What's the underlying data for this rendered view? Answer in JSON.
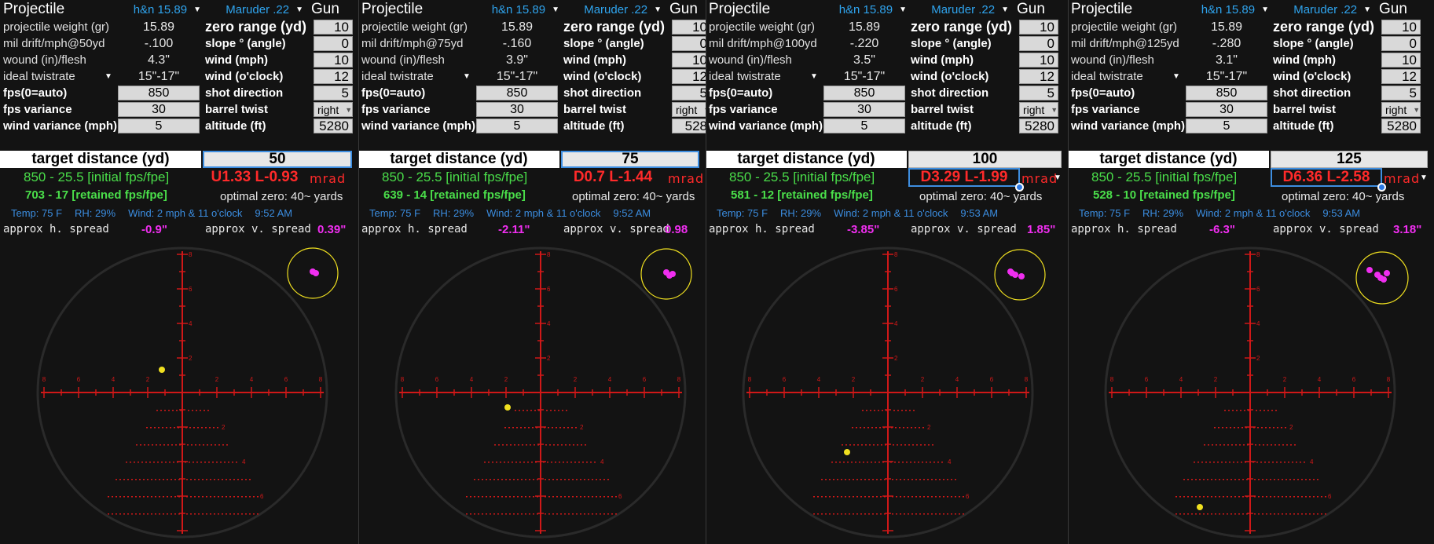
{
  "colors": {
    "background": "#131313",
    "selector_text": "#2fa4ee",
    "hold_red": "#ff2a2a",
    "fps_green": "#4ade4a",
    "spread_magenta": "#f02ef0",
    "weather_blue": "#3b8de0",
    "reticle_red": "#d01818",
    "impact_yellow": "#f0e020"
  },
  "labels": {
    "projectile": "Projectile",
    "gun": "Gun",
    "projectile_weight": "projectile weight (gr)",
    "wound": "wound (in)/flesh",
    "ideal_twistrate": "ideal twistrate",
    "fps_auto": "fps(0=auto)",
    "fps_variance": "fps variance",
    "wind_variance": "wind variance (mph)",
    "zero_range": "zero range (yd)",
    "slope": "slope ° (angle)",
    "wind_mph": "wind (mph)",
    "wind_oclock": "wind (o'clock)",
    "shot_direction": "shot direction",
    "barrel_twist": "barrel twist",
    "altitude": "altitude (ft)",
    "target_distance": "target distance (yd)",
    "approx_h_spread": "approx h. spread",
    "approx_v_spread": "approx v. spread",
    "mrad_unit": "mrad"
  },
  "panels": [
    {
      "projectile_select": "h&n 15.89",
      "gun_select": "Maruder .22",
      "projectile_weight": "15.89",
      "mil_drift_label": "mil drift/mph@50yd",
      "mil_drift": "-.100",
      "wound": "4.3\"",
      "twistrate": "15\"-17\"",
      "fps": "850",
      "fps_variance": "30",
      "wind_variance": "5",
      "zero_range": "10",
      "slope": "0",
      "wind_mph": "10",
      "wind_oclock": "12",
      "shot_direction": "5",
      "barrel_twist": "right",
      "altitude": "5280",
      "target_distance": "50",
      "initial": "850 - 25.5 [initial fps/fpe]",
      "retained": "703 - 17 [retained fps/fpe]",
      "hold": "U1.33  L-0.93",
      "optimal_zero": "optimal zero: 40~ yards",
      "temp": "Temp: 75 F",
      "rh": "RH: 29%",
      "wind_info": "Wind: 2 mph & 11 o'clock",
      "time": "9:52 AM",
      "h_spread": "-0.9\"",
      "v_spread": "0.39\""
    },
    {
      "projectile_select": "h&n 15.89",
      "gun_select": "Maruder .22",
      "projectile_weight": "15.89",
      "mil_drift_label": "mil drift/mph@75yd",
      "mil_drift": "-.160",
      "wound": "3.9\"",
      "twistrate": "15\"-17\"",
      "fps": "850",
      "fps_variance": "30",
      "wind_variance": "5",
      "zero_range": "10",
      "slope": "0",
      "wind_mph": "10",
      "wind_oclock": "12",
      "shot_direction": "5",
      "barrel_twist": "right",
      "altitude": "528",
      "target_distance": "75",
      "initial": "850 - 25.5 [initial fps/fpe]",
      "retained": "639 - 14 [retained fps/fpe]",
      "hold": "D0.7  L-1.44",
      "optimal_zero": "optimal zero: 40~ yards",
      "temp": "Temp: 75 F",
      "rh": "RH: 29%",
      "wind_info": "Wind: 2 mph & 11 o'clock",
      "time": "9:52 AM",
      "h_spread": "-2.11\"",
      "v_spread": "0.98"
    },
    {
      "projectile_select": "h&n 15.89",
      "gun_select": "Maruder .22",
      "projectile_weight": "15.89",
      "mil_drift_label": "mil drift/mph@100yd",
      "mil_drift": "-.220",
      "wound": "3.5\"",
      "twistrate": "15\"-17\"",
      "fps": "850",
      "fps_variance": "30",
      "wind_variance": "5",
      "zero_range": "10",
      "slope": "0",
      "wind_mph": "10",
      "wind_oclock": "12",
      "shot_direction": "5",
      "barrel_twist": "right",
      "altitude": "5280",
      "target_distance": "100",
      "initial": "850 - 25.5 [initial fps/fpe]",
      "retained": "581 - 12 [retained fps/fpe]",
      "hold": "D3.29  L-1.99",
      "optimal_zero": "optimal zero: 40~ yards",
      "temp": "Temp: 75 F",
      "rh": "RH: 29%",
      "wind_info": "Wind: 2 mph & 11 o'clock",
      "time": "9:53 AM",
      "h_spread": "-3.85\"",
      "v_spread": "1.85\""
    },
    {
      "projectile_select": "h&n 15.89",
      "gun_select": "Maruder .22",
      "projectile_weight": "15.89",
      "mil_drift_label": "mil drift/mph@125yd",
      "mil_drift": "-.280",
      "wound": "3.1\"",
      "twistrate": "15\"-17\"",
      "fps": "850",
      "fps_variance": "30",
      "wind_variance": "5",
      "zero_range": "10",
      "slope": "0",
      "wind_mph": "10",
      "wind_oclock": "12",
      "shot_direction": "5",
      "barrel_twist": "right",
      "altitude": "5280",
      "target_distance": "125",
      "initial": "850 - 25.5 [initial fps/fpe]",
      "retained": "528 - 10 [retained fps/fpe]",
      "hold": "D6.36  L-2.58",
      "optimal_zero": "optimal zero: 40~ yards",
      "temp": "Temp: 75 F",
      "rh": "RH: 29%",
      "wind_info": "Wind: 2 mph & 11 o'clock",
      "time": "9:53 AM",
      "h_spread": "-6.3\"",
      "v_spread": "3.18\""
    }
  ],
  "reticle": {
    "h_tick_labels": [
      "8",
      "6",
      "4",
      "2",
      "2",
      "4",
      "6",
      "8"
    ],
    "v_tick_labels_top": [
      "8",
      "6",
      "4",
      "2"
    ],
    "v_tick_labels_bottom": [
      "2",
      "4",
      "6"
    ]
  }
}
